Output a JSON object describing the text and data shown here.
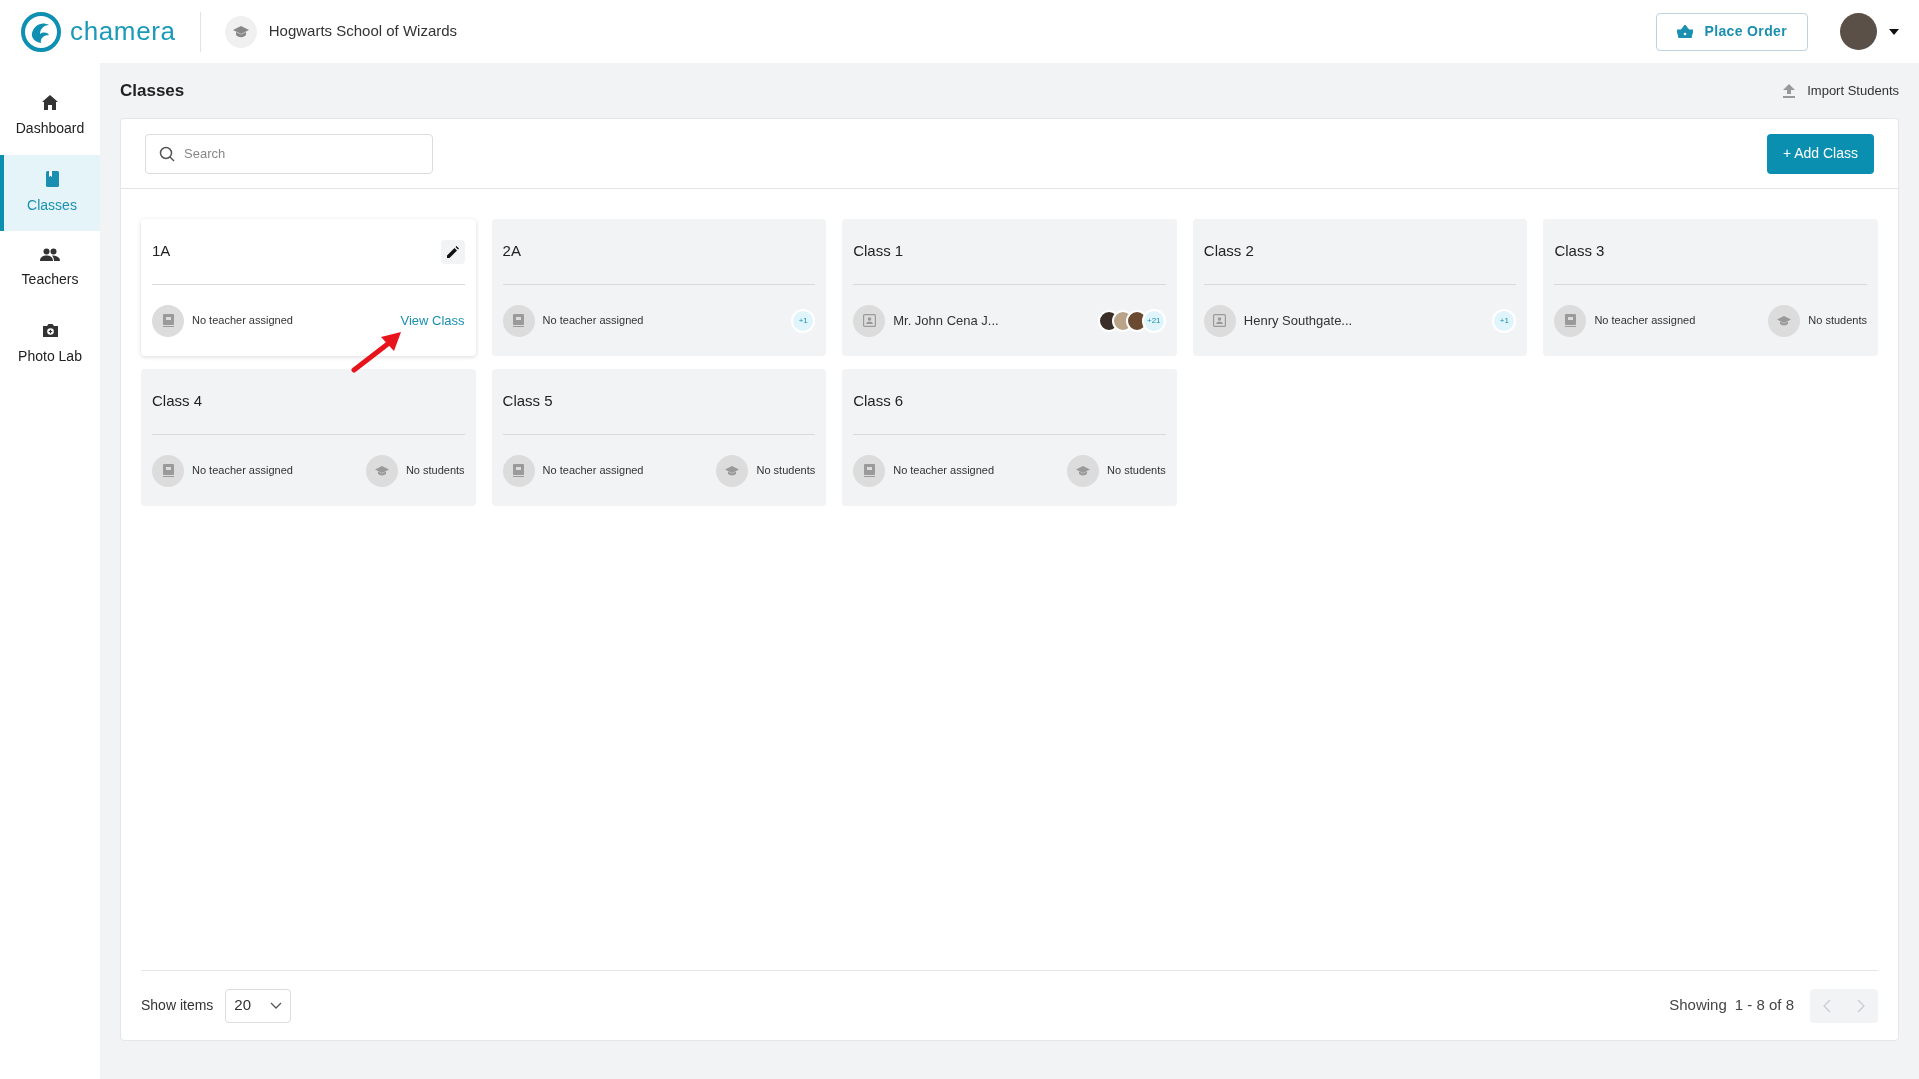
{
  "header": {
    "brand": "chamera",
    "school": "Hogwarts School of Wizards",
    "place_order": "Place Order"
  },
  "sidebar": {
    "items": [
      {
        "kind": "home",
        "label": "Dashboard",
        "selected": false
      },
      {
        "kind": "book",
        "label": "Classes",
        "selected": true
      },
      {
        "kind": "people",
        "label": "Teachers",
        "selected": false
      },
      {
        "kind": "camera",
        "label": "Photo Lab",
        "selected": false
      }
    ]
  },
  "page": {
    "title": "Classes",
    "import": "Import Students",
    "search": {
      "placeholder": "Search"
    },
    "add_button": "+ Add Class"
  },
  "classes": [
    {
      "name": "1A",
      "highlighted": true,
      "teacher": {
        "kind": "none",
        "text": "No teacher assigned"
      },
      "students": {
        "kind": "link",
        "text": "View Class"
      }
    },
    {
      "name": "2A",
      "highlighted": false,
      "teacher": {
        "kind": "none",
        "text": "No teacher assigned"
      },
      "students": {
        "kind": "count",
        "text": "+1"
      }
    },
    {
      "name": "Class 1",
      "highlighted": false,
      "teacher": {
        "kind": "assigned",
        "text": "Mr. John Cena J..."
      },
      "students": {
        "kind": "avatars",
        "text": "+21"
      }
    },
    {
      "name": "Class 2",
      "highlighted": false,
      "teacher": {
        "kind": "assigned",
        "text": "Henry Southgate..."
      },
      "students": {
        "kind": "count",
        "text": "+1"
      }
    },
    {
      "name": "Class 3",
      "highlighted": false,
      "teacher": {
        "kind": "none",
        "text": "No teacher assigned"
      },
      "students": {
        "kind": "none",
        "text": "No students"
      }
    },
    {
      "name": "Class 4",
      "highlighted": false,
      "teacher": {
        "kind": "none",
        "text": "No teacher assigned"
      },
      "students": {
        "kind": "none",
        "text": "No students"
      }
    },
    {
      "name": "Class 5",
      "highlighted": false,
      "teacher": {
        "kind": "none",
        "text": "No teacher assigned"
      },
      "students": {
        "kind": "none",
        "text": "No students"
      }
    },
    {
      "name": "Class 6",
      "highlighted": false,
      "teacher": {
        "kind": "none",
        "text": "No teacher assigned"
      },
      "students": {
        "kind": "none",
        "text": "No students"
      }
    }
  ],
  "footer": {
    "show_items_label": "Show items",
    "page_size": "20",
    "showing_label": "Showing",
    "range": "1 - 8 of 8",
    "prev_disabled": true,
    "next_disabled": true
  }
}
